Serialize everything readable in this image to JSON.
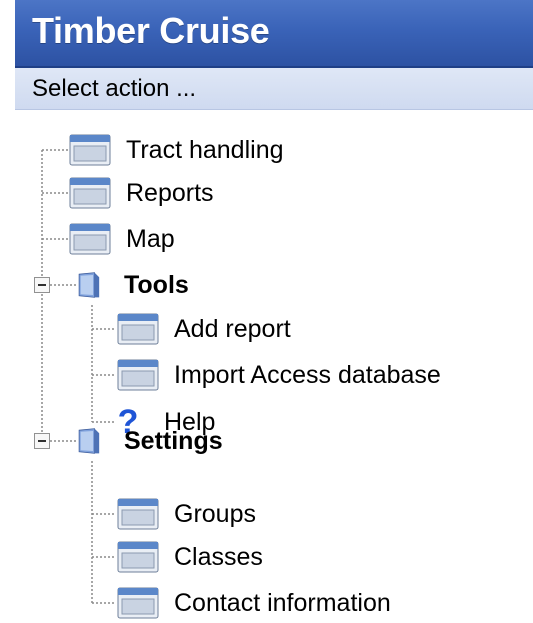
{
  "header": {
    "title": "Timber Cruise",
    "subtitle": "Select action ..."
  },
  "tree": {
    "items": [
      {
        "label": "Tract handling",
        "icon": "form-icon"
      },
      {
        "label": "Reports",
        "icon": "form-icon"
      },
      {
        "label": "Map",
        "icon": "form-icon"
      },
      {
        "label": "Tools",
        "icon": "book-icon",
        "expanded": true,
        "children": [
          {
            "label": "Add report",
            "icon": "form-icon"
          },
          {
            "label": "Import Access database",
            "icon": "form-icon"
          },
          {
            "label": "Help",
            "icon": "help-icon"
          }
        ]
      },
      {
        "label": "Settings",
        "icon": "book-icon",
        "expanded": true,
        "children": [
          {
            "label": "Groups",
            "icon": "form-icon"
          },
          {
            "label": "Classes",
            "icon": "form-icon"
          },
          {
            "label": "Contact information",
            "icon": "form-icon"
          }
        ]
      }
    ]
  },
  "colors": {
    "title_bg": "#3a63b8",
    "subbar_bg": "#d6e0f3",
    "help_icon": "#1f55d6"
  }
}
